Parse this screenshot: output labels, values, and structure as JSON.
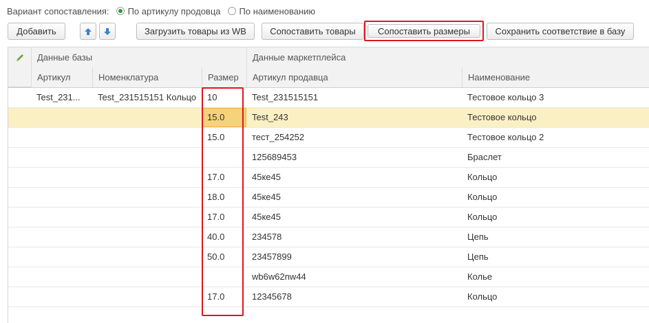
{
  "variant": {
    "label": "Вариант сопоставления:",
    "options": [
      {
        "label": "По артикулу продовца",
        "selected": true
      },
      {
        "label": "По наименованию",
        "selected": false
      }
    ]
  },
  "toolbar": {
    "add": "Добавить",
    "load_wb": "Загрузить товары из WB",
    "match_goods": "Сопоставить товары",
    "match_sizes": "Сопоставить размеры",
    "save_match": "Сохранить соответствие в базу",
    "up_icon": "arrow-up-icon",
    "down_icon": "arrow-down-icon"
  },
  "grid": {
    "group_base": "Данные базы",
    "group_market": "Данные маркетплейса",
    "columns": {
      "article": "Артикул",
      "nomenclature": "Номенклатура",
      "size": "Размер",
      "seller_article": "Артикул продавца",
      "name": "Наименование"
    },
    "rows": [
      {
        "article": "Test_231...",
        "nomenclature": "Test_231515151 Кольцо",
        "size": "10",
        "seller_article": "Test_231515151",
        "name": "Тестовое кольцо 3"
      },
      {
        "article": "",
        "nomenclature": "",
        "size": "15.0",
        "seller_article": "Test_243",
        "name": "Тестовое кольцо"
      },
      {
        "article": "",
        "nomenclature": "",
        "size": "15.0",
        "seller_article": "тест_254252",
        "name": "Тестовое кольцо 2"
      },
      {
        "article": "",
        "nomenclature": "",
        "size": "",
        "seller_article": "125689453",
        "name": "Браслет"
      },
      {
        "article": "",
        "nomenclature": "",
        "size": "17.0",
        "seller_article": "45ке45",
        "name": "Кольцо"
      },
      {
        "article": "",
        "nomenclature": "",
        "size": "18.0",
        "seller_article": "45ке45",
        "name": "Кольцо"
      },
      {
        "article": "",
        "nomenclature": "",
        "size": "17.0",
        "seller_article": "45ке45",
        "name": "Кольцо"
      },
      {
        "article": "",
        "nomenclature": "",
        "size": "40.0",
        "seller_article": "234578",
        "name": "Цепь"
      },
      {
        "article": "",
        "nomenclature": "",
        "size": "50.0",
        "seller_article": "23457899",
        "name": "Цепь"
      },
      {
        "article": "",
        "nomenclature": "",
        "size": "",
        "seller_article": "wb6w62nw44",
        "name": "Колье"
      },
      {
        "article": "",
        "nomenclature": "",
        "size": "17.0",
        "seller_article": "12345678",
        "name": "Кольцо"
      }
    ]
  },
  "colors": {
    "highlight": "#e0141b",
    "selected_row": "#fbf0c4",
    "active_cell": "#f6d27a",
    "radio_on": "#2f9a3f",
    "arrow": "#3b7fd0"
  }
}
